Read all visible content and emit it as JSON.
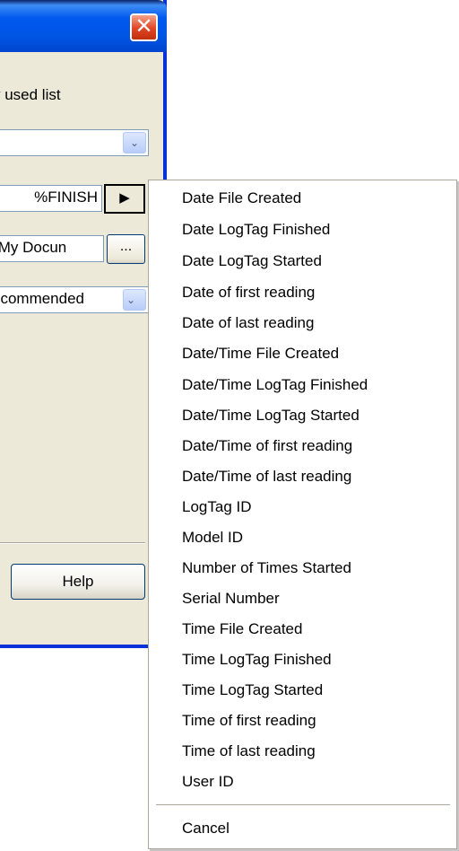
{
  "dialog": {
    "close_glyph": "✕",
    "label_used_list": "y used list",
    "combo_top_value": "",
    "combo_dropdown_glyph": "⌄",
    "finish_field_value": "%FINISH",
    "arrow_button_glyph": "▶",
    "path_field_value": "\\My Docun",
    "browse_label": "...",
    "combo_bottom_value": "ecommended",
    "help_label": "Help"
  },
  "menu": {
    "items": [
      "Date File Created",
      "Date LogTag Finished",
      "Date LogTag Started",
      "Date of first reading",
      "Date of last reading",
      "Date/Time File Created",
      "Date/Time LogTag Finished",
      "Date/Time LogTag Started",
      "Date/Time of first reading",
      "Date/Time of last reading",
      "LogTag ID",
      "Model ID",
      "Number of Times Started",
      "Serial Number",
      "Time File Created",
      "Time LogTag Finished",
      "Time LogTag Started",
      "Time of first reading",
      "Time of last reading",
      "User ID"
    ],
    "cancel_label": "Cancel"
  }
}
